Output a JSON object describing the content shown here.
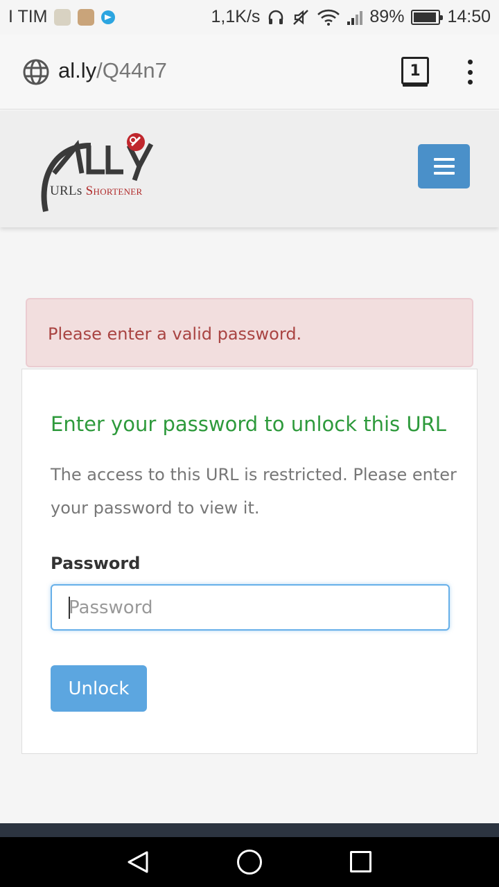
{
  "status_bar": {
    "carrier": "I TIM",
    "net_speed": "1,1K/s",
    "battery": "89%",
    "time": "14:50"
  },
  "browser": {
    "url_host": "al.ly",
    "url_path": "/Q44n7",
    "tab_count": "1"
  },
  "header": {
    "logo_text_a": "URLs",
    "logo_text_b": "Shortener",
    "menu_icon": "hamburger-icon",
    "accent": "#4a90c9"
  },
  "alert": {
    "message": "Please enter a valid password."
  },
  "form": {
    "title": "Enter your password to unlock this URL",
    "description": "The access to this URL is restricted. Please enter your password to view it.",
    "password_label": "Password",
    "password_placeholder": "Password",
    "password_value": "",
    "unlock_label": "Unlock"
  },
  "colors": {
    "title_green": "#2e9a3c",
    "alert_text": "#a94442",
    "alert_bg": "#f2dede",
    "button_blue": "#5ca6e0"
  }
}
